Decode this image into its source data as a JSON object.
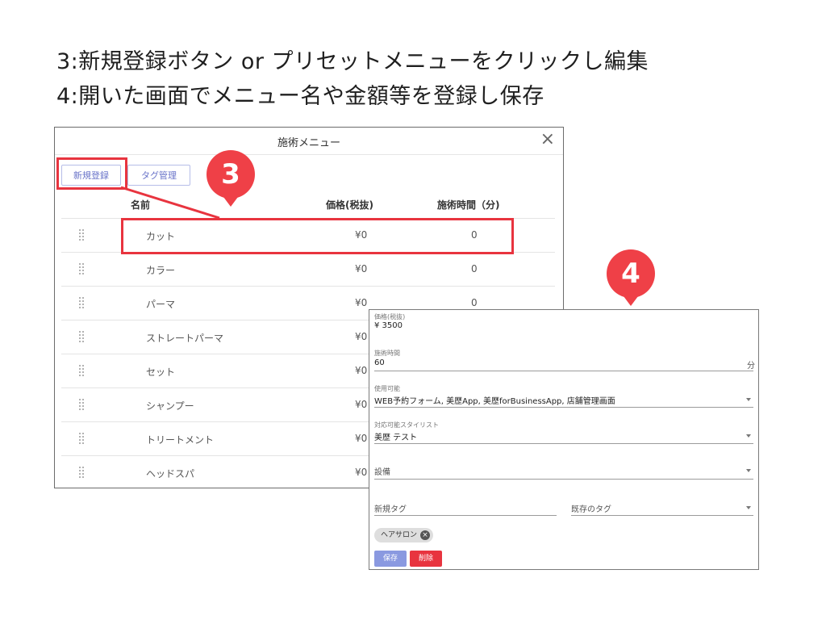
{
  "instructions": {
    "line1": "3:新規登録ボタン or プリセットメニューをクリックし編集",
    "line2": "4:開いた画面でメニュー名や金額等を登録し保存"
  },
  "dialog": {
    "title": "施術メニュー",
    "close_symbol": "×",
    "buttons": {
      "new_label": "新規登録",
      "tag_label": "タグ管理"
    },
    "columns": {
      "name": "名前",
      "price": "価格(税抜)",
      "time": "施術時間（分)"
    },
    "rows": [
      {
        "name": "カット",
        "price": "¥0",
        "time": "0"
      },
      {
        "name": "カラー",
        "price": "¥0",
        "time": "0"
      },
      {
        "name": "パーマ",
        "price": "¥0",
        "time": "0"
      },
      {
        "name": "ストレートパーマ",
        "price": "¥0",
        "time": ""
      },
      {
        "name": "セット",
        "price": "¥0",
        "time": ""
      },
      {
        "name": "シャンプー",
        "price": "¥0",
        "time": ""
      },
      {
        "name": "トリートメント",
        "price": "¥0",
        "time": ""
      },
      {
        "name": "ヘッドスパ",
        "price": "¥0",
        "time": ""
      }
    ]
  },
  "markers": {
    "step3": "3",
    "step4": "4"
  },
  "form": {
    "price": {
      "label": "価格(税抜)",
      "value": "¥ 3500"
    },
    "duration": {
      "label": "施術時間",
      "value": "60",
      "unit": "分"
    },
    "usable": {
      "label": "使用可能",
      "value": "WEB予約フォーム, 美歴App, 美歴forBusinessApp, 店舗管理画面"
    },
    "stylist": {
      "label": "対応可能スタイリスト",
      "value": "美歴 テスト"
    },
    "equipment": {
      "placeholder": "設備"
    },
    "new_tag": {
      "placeholder": "新規タグ"
    },
    "existing_tag": {
      "placeholder": "既存のタグ"
    },
    "chip": {
      "label": "ヘアサロン",
      "remove_symbol": "×"
    },
    "save_label": "保存",
    "delete_label": "削除"
  },
  "colors": {
    "accent_red": "#ef4047",
    "primary_blue": "#8a99e0",
    "outline_blue": "#6a74c9"
  }
}
